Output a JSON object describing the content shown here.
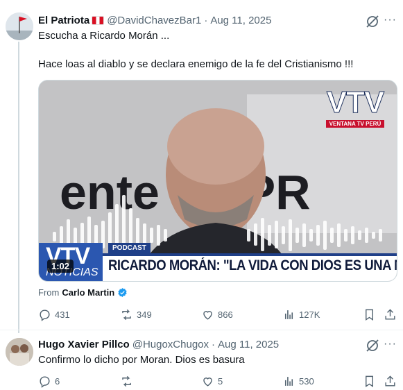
{
  "tweets": [
    {
      "author_name": "El Patriota",
      "handle": "@DavidChavezBar1",
      "separator": "·",
      "date": "Aug 11, 2025",
      "text_line1": "Escucha a Ricardo Morán ...",
      "text_line2": "Hace loas al diablo y se declara enemigo de la fe del Cristianismo !!!",
      "media": {
        "brand": "VTV",
        "brand_sub": "VENTANA TV PERÚ",
        "bg_text": "ente  DUPR",
        "tag": "PODCAST",
        "headline": "RICARDO MORÁN: \"LA VIDA CON DIOS ES UNA MIER...\"",
        "lower_brand": "VTV",
        "lower_brand_sub": "NOTICIAS",
        "duration": "1:02"
      },
      "source_prefix": "From",
      "source_name": "Carlo Martin",
      "stats": {
        "replies": "431",
        "retweets": "349",
        "likes": "866",
        "views": "127K"
      }
    },
    {
      "author_name": "Hugo Xavier Pillco",
      "handle": "@HugoxChugox",
      "separator": "·",
      "date": "Aug 11, 2025",
      "text_line1": "Confirmo lo dicho por Moran. Dios es basura",
      "stats": {
        "replies": "6",
        "retweets": "",
        "likes": "5",
        "views": "530"
      }
    }
  ],
  "icons": {
    "grok": "grok-icon",
    "more": "more-icon",
    "reply": "reply-icon",
    "retweet": "retweet-icon",
    "like": "like-icon",
    "views": "views-icon",
    "bookmark": "bookmark-icon",
    "share": "share-icon",
    "verified": "verified-badge-icon"
  },
  "colors": {
    "text": "#0f1419",
    "muted": "#536471",
    "verified": "#1d9bf0",
    "border": "#cfd9de"
  }
}
